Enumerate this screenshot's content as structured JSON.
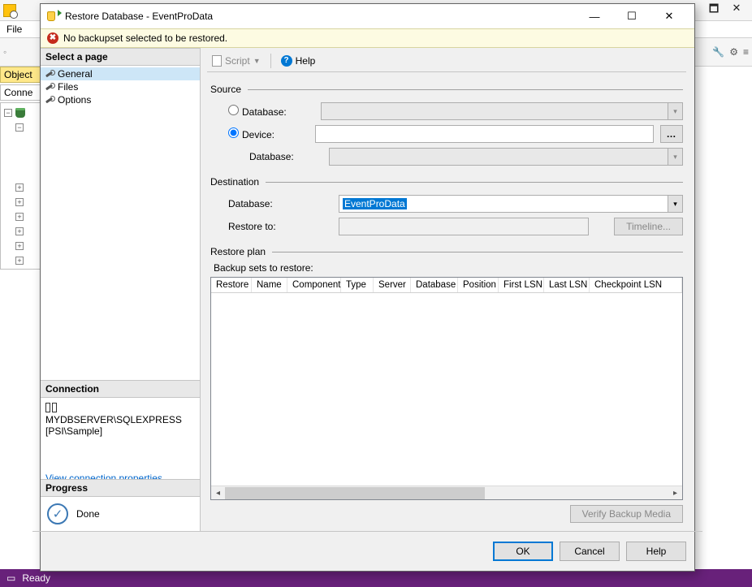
{
  "app": {
    "menu_file": "File",
    "side_object": "Object",
    "side_conn": "Conne",
    "status": "Ready"
  },
  "dialog": {
    "title": "Restore Database - EventProData",
    "warning": "No backupset selected to be restored.",
    "pages_header": "Select a page",
    "pages": {
      "general": "General",
      "files": "Files",
      "options": "Options"
    },
    "connection_header": "Connection",
    "connection_server": "MYDBSERVER\\SQLEXPRESS",
    "connection_user": "[PSI\\Sample]",
    "connection_link": "View connection properties",
    "progress_header": "Progress",
    "progress_text": "Done",
    "toolbar": {
      "script": "Script",
      "help": "Help"
    },
    "source": {
      "label": "Source",
      "rb_database": "Database:",
      "rb_device": "Device:",
      "sub_database": "Database:"
    },
    "destination": {
      "label": "Destination",
      "database_label": "Database:",
      "database_value": "EventProData",
      "restore_to_label": "Restore to:",
      "timeline_btn": "Timeline..."
    },
    "restoreplan": {
      "label": "Restore plan",
      "sets_label": "Backup sets to restore:",
      "cols": [
        "Restore",
        "Name",
        "Component",
        "Type",
        "Server",
        "Database",
        "Position",
        "First LSN",
        "Last LSN",
        "Checkpoint LSN"
      ]
    },
    "verify_btn": "Verify Backup Media",
    "buttons": {
      "ok": "OK",
      "cancel": "Cancel",
      "help": "Help"
    }
  }
}
